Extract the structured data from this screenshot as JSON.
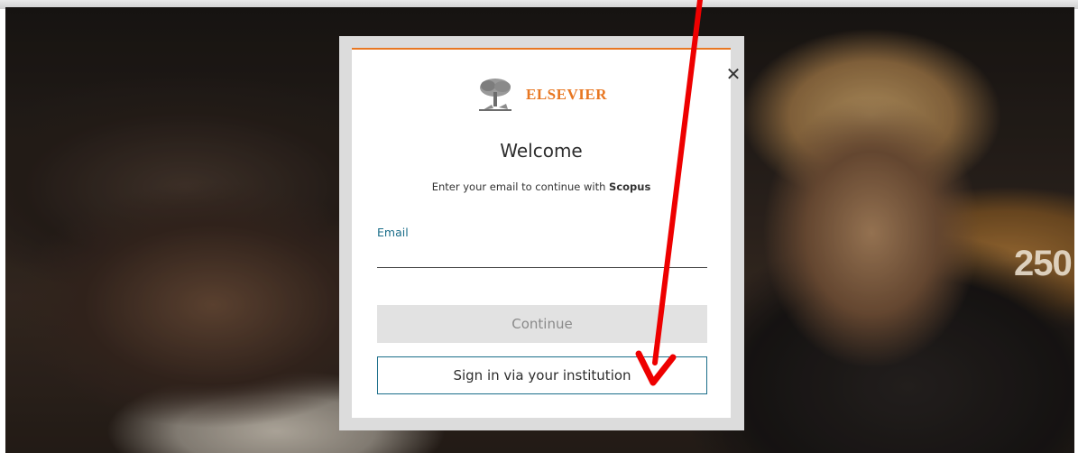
{
  "background": {
    "seat_number": "250"
  },
  "modal": {
    "brand": "ELSEVIER",
    "title": "Welcome",
    "subtitle_prefix": "Enter your email to continue with ",
    "subtitle_product": "Scopus",
    "email_label": "Email",
    "email_value": "",
    "continue_label": "Continue",
    "institution_label": "Sign in via your institution",
    "close_symbol": "✕",
    "icons": {
      "close": "close-icon",
      "logo": "elsevier-tree-logo"
    },
    "colors": {
      "brand_orange": "#e87722",
      "accent_teal": "#1b6e8a",
      "disabled_bg": "#e2e2e2"
    }
  },
  "annotation": {
    "type": "red-arrow",
    "color": "#ee0000",
    "points_to": "institution-button"
  }
}
